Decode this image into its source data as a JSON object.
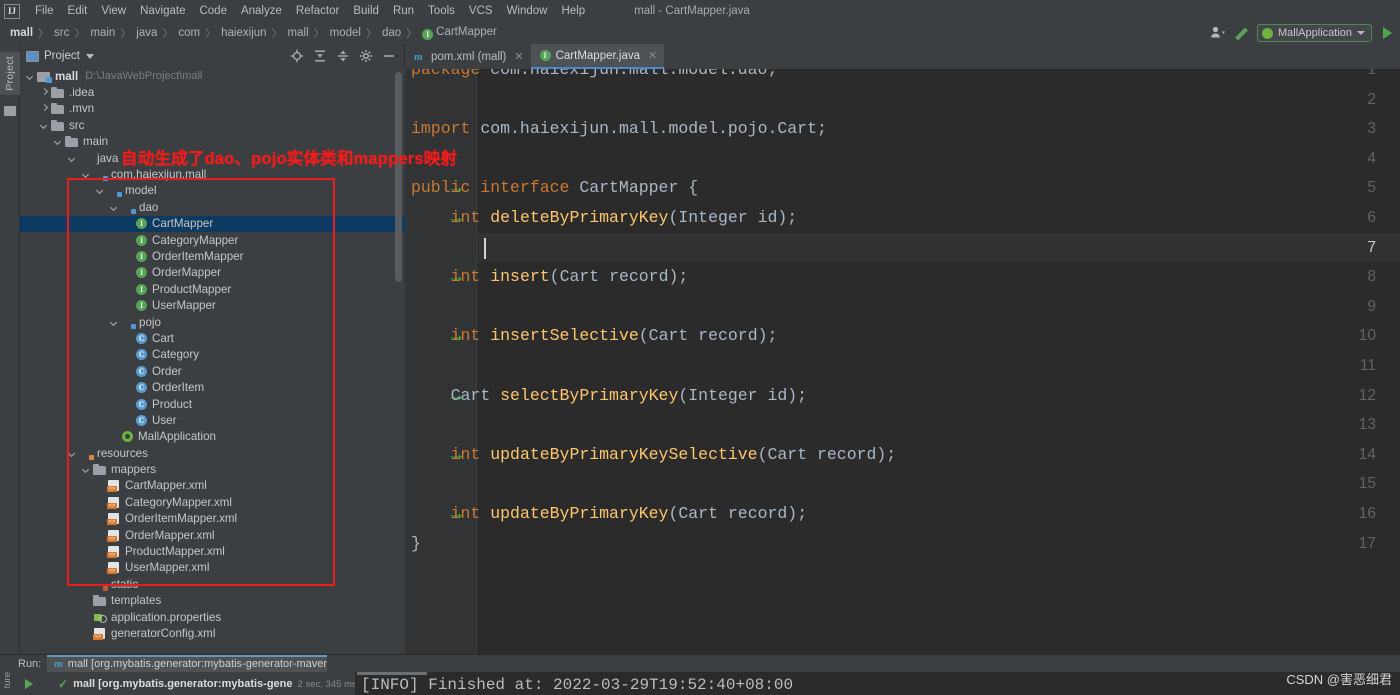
{
  "window": {
    "title": "mall - CartMapper.java",
    "logo": "intellij-idea-logo"
  },
  "menubar": {
    "items": [
      "File",
      "Edit",
      "View",
      "Navigate",
      "Code",
      "Analyze",
      "Refactor",
      "Build",
      "Run",
      "Tools",
      "VCS",
      "Window",
      "Help"
    ]
  },
  "breadcrumb": {
    "items": [
      "mall",
      "src",
      "main",
      "java",
      "com",
      "haiexijun",
      "mall",
      "model",
      "dao",
      "CartMapper"
    ],
    "last_icon": "interface-icon"
  },
  "toolbar_right": {
    "user_icon": "user-avatar-icon",
    "build_icon": "hammer-icon",
    "run_config": "MallApplication",
    "run_config_icon": "spring-boot-icon",
    "run_icon": "run-play-icon"
  },
  "left_strip": {
    "project_tab": "Project"
  },
  "project_panel": {
    "title": "Project",
    "tools": [
      "locate-icon",
      "expand-all-icon",
      "collapse-all-icon",
      "settings-gear-icon",
      "hide-icon"
    ],
    "tree": [
      {
        "label": "mall",
        "path": "D:\\JavaWebProject\\mall",
        "icon": "module-icon",
        "arrow": "down",
        "indent": 0,
        "bold": true
      },
      {
        "label": ".idea",
        "icon": "folder-icon",
        "arrow": "right",
        "indent": 1
      },
      {
        "label": ".mvn",
        "icon": "folder-icon",
        "arrow": "right",
        "indent": 1
      },
      {
        "label": "src",
        "icon": "folder-icon",
        "arrow": "down",
        "indent": 1
      },
      {
        "label": "main",
        "icon": "folder-icon",
        "arrow": "down",
        "indent": 2
      },
      {
        "label": "java",
        "icon": "source-folder-icon",
        "arrow": "down",
        "indent": 3
      },
      {
        "label": "com.haiexijun.mall",
        "icon": "package-folder-icon",
        "arrow": "down",
        "indent": 4
      },
      {
        "label": "model",
        "icon": "package-folder-icon",
        "arrow": "down",
        "indent": 5
      },
      {
        "label": "dao",
        "icon": "package-folder-icon",
        "arrow": "down",
        "indent": 6
      },
      {
        "label": "CartMapper",
        "icon": "interface-icon",
        "indent": 7,
        "selected": true
      },
      {
        "label": "CategoryMapper",
        "icon": "interface-icon",
        "indent": 7
      },
      {
        "label": "OrderItemMapper",
        "icon": "interface-icon",
        "indent": 7
      },
      {
        "label": "OrderMapper",
        "icon": "interface-icon",
        "indent": 7
      },
      {
        "label": "ProductMapper",
        "icon": "interface-icon",
        "indent": 7
      },
      {
        "label": "UserMapper",
        "icon": "interface-icon",
        "indent": 7
      },
      {
        "label": "pojo",
        "icon": "package-folder-icon",
        "arrow": "down",
        "indent": 6
      },
      {
        "label": "Cart",
        "icon": "class-icon",
        "indent": 7
      },
      {
        "label": "Category",
        "icon": "class-icon",
        "indent": 7
      },
      {
        "label": "Order",
        "icon": "class-icon",
        "indent": 7
      },
      {
        "label": "OrderItem",
        "icon": "class-icon",
        "indent": 7
      },
      {
        "label": "Product",
        "icon": "class-icon",
        "indent": 7
      },
      {
        "label": "User",
        "icon": "class-icon",
        "indent": 7
      },
      {
        "label": "MallApplication",
        "icon": "spring-boot-class-icon",
        "indent": 6
      },
      {
        "label": "resources",
        "icon": "resources-folder-icon",
        "arrow": "down",
        "indent": 3
      },
      {
        "label": "mappers",
        "icon": "folder-icon",
        "arrow": "down",
        "indent": 4
      },
      {
        "label": "CartMapper.xml",
        "icon": "xml-file-icon",
        "indent": 5
      },
      {
        "label": "CategoryMapper.xml",
        "icon": "xml-file-icon",
        "indent": 5
      },
      {
        "label": "OrderItemMapper.xml",
        "icon": "xml-file-icon",
        "indent": 5
      },
      {
        "label": "OrderMapper.xml",
        "icon": "xml-file-icon",
        "indent": 5
      },
      {
        "label": "ProductMapper.xml",
        "icon": "xml-file-icon",
        "indent": 5
      },
      {
        "label": "UserMapper.xml",
        "icon": "xml-file-icon",
        "indent": 5
      },
      {
        "label": "static",
        "icon": "static-folder-icon",
        "indent": 4
      },
      {
        "label": "templates",
        "icon": "folder-icon",
        "indent": 4
      },
      {
        "label": "application.properties",
        "icon": "properties-file-icon",
        "indent": 4
      },
      {
        "label": "generatorConfig.xml",
        "icon": "xml-file-icon",
        "indent": 4
      }
    ]
  },
  "annotation": {
    "text": "自动生成了dao、pojo实体类和mappers映射",
    "color": "#ef1c1c",
    "box_color": "#e81d1d"
  },
  "editor": {
    "tabs": [
      {
        "label": "pom.xml (mall)",
        "icon": "maven-icon",
        "active": false
      },
      {
        "label": "CartMapper.java",
        "icon": "interface-icon",
        "active": true
      }
    ],
    "current_line": 7,
    "lines": [
      {
        "num": "1",
        "impl": false,
        "tokens": [
          {
            "t": "package",
            "c": "kw"
          },
          {
            "t": " com.haiexijun.mall.model.dao;",
            "c": "pl"
          }
        ]
      },
      {
        "num": "2",
        "impl": false,
        "tokens": []
      },
      {
        "num": "3",
        "impl": false,
        "tokens": [
          {
            "t": "import",
            "c": "kw"
          },
          {
            "t": " com.haiexijun.mall.model.pojo.Cart;",
            "c": "pl"
          }
        ]
      },
      {
        "num": "4",
        "impl": false,
        "tokens": []
      },
      {
        "num": "5",
        "impl": true,
        "tokens": [
          {
            "t": "public interface ",
            "c": "kw"
          },
          {
            "t": "CartMapper",
            "c": "ty"
          },
          {
            "t": " {",
            "c": "pl"
          }
        ]
      },
      {
        "num": "6",
        "impl": true,
        "tokens": [
          {
            "t": "    ",
            "c": "pl"
          },
          {
            "t": "int",
            "c": "kw"
          },
          {
            "t": " ",
            "c": "pl"
          },
          {
            "t": "deleteByPrimaryKey",
            "c": "mth"
          },
          {
            "t": "(",
            "c": "pl"
          },
          {
            "t": "Integer",
            "c": "ty"
          },
          {
            "t": " id);",
            "c": "pl"
          }
        ]
      },
      {
        "num": "7",
        "impl": false,
        "tokens": []
      },
      {
        "num": "8",
        "impl": true,
        "tokens": [
          {
            "t": "    ",
            "c": "pl"
          },
          {
            "t": "int",
            "c": "kw"
          },
          {
            "t": " ",
            "c": "pl"
          },
          {
            "t": "insert",
            "c": "mth"
          },
          {
            "t": "(",
            "c": "pl"
          },
          {
            "t": "Cart",
            "c": "ty"
          },
          {
            "t": " record);",
            "c": "pl"
          }
        ]
      },
      {
        "num": "9",
        "impl": false,
        "tokens": []
      },
      {
        "num": "10",
        "impl": true,
        "tokens": [
          {
            "t": "    ",
            "c": "pl"
          },
          {
            "t": "int",
            "c": "kw"
          },
          {
            "t": " ",
            "c": "pl"
          },
          {
            "t": "insertSelective",
            "c": "mth"
          },
          {
            "t": "(",
            "c": "pl"
          },
          {
            "t": "Cart",
            "c": "ty"
          },
          {
            "t": " record);",
            "c": "pl"
          }
        ]
      },
      {
        "num": "11",
        "impl": false,
        "tokens": []
      },
      {
        "num": "12",
        "impl": true,
        "tokens": [
          {
            "t": "    ",
            "c": "pl"
          },
          {
            "t": "Cart",
            "c": "ty"
          },
          {
            "t": " ",
            "c": "pl"
          },
          {
            "t": "selectByPrimaryKey",
            "c": "mth"
          },
          {
            "t": "(",
            "c": "pl"
          },
          {
            "t": "Integer",
            "c": "ty"
          },
          {
            "t": " id);",
            "c": "pl"
          }
        ]
      },
      {
        "num": "13",
        "impl": false,
        "tokens": []
      },
      {
        "num": "14",
        "impl": true,
        "tokens": [
          {
            "t": "    ",
            "c": "pl"
          },
          {
            "t": "int",
            "c": "kw"
          },
          {
            "t": " ",
            "c": "pl"
          },
          {
            "t": "updateByPrimaryKeySelective",
            "c": "mth"
          },
          {
            "t": "(",
            "c": "pl"
          },
          {
            "t": "Cart",
            "c": "ty"
          },
          {
            "t": " record);",
            "c": "pl"
          }
        ]
      },
      {
        "num": "15",
        "impl": false,
        "tokens": []
      },
      {
        "num": "16",
        "impl": true,
        "tokens": [
          {
            "t": "    ",
            "c": "pl"
          },
          {
            "t": "int",
            "c": "kw"
          },
          {
            "t": " ",
            "c": "pl"
          },
          {
            "t": "updateByPrimaryKey",
            "c": "mth"
          },
          {
            "t": "(",
            "c": "pl"
          },
          {
            "t": "Cart",
            "c": "ty"
          },
          {
            "t": " record);",
            "c": "pl"
          }
        ]
      },
      {
        "num": "17",
        "impl": false,
        "tokens": [
          {
            "t": "}",
            "c": "pl"
          }
        ]
      }
    ]
  },
  "run_panel": {
    "label": "Run:",
    "tab_label": "mall [org.mybatis.generator:mybatis-generator-maven-plugi...",
    "tab_icon": "maven-icon",
    "vertical_label": "ture",
    "node_name": "mall [org.mybatis.generator:mybatis-gene",
    "node_time": "2 sec, 345 ms",
    "node_status_icon": "success-check-icon",
    "console_line": "[INFO] Finished at: 2022-03-29T19:52:40+08:00"
  },
  "watermark": {
    "text": "CSDN @害恶细君"
  }
}
